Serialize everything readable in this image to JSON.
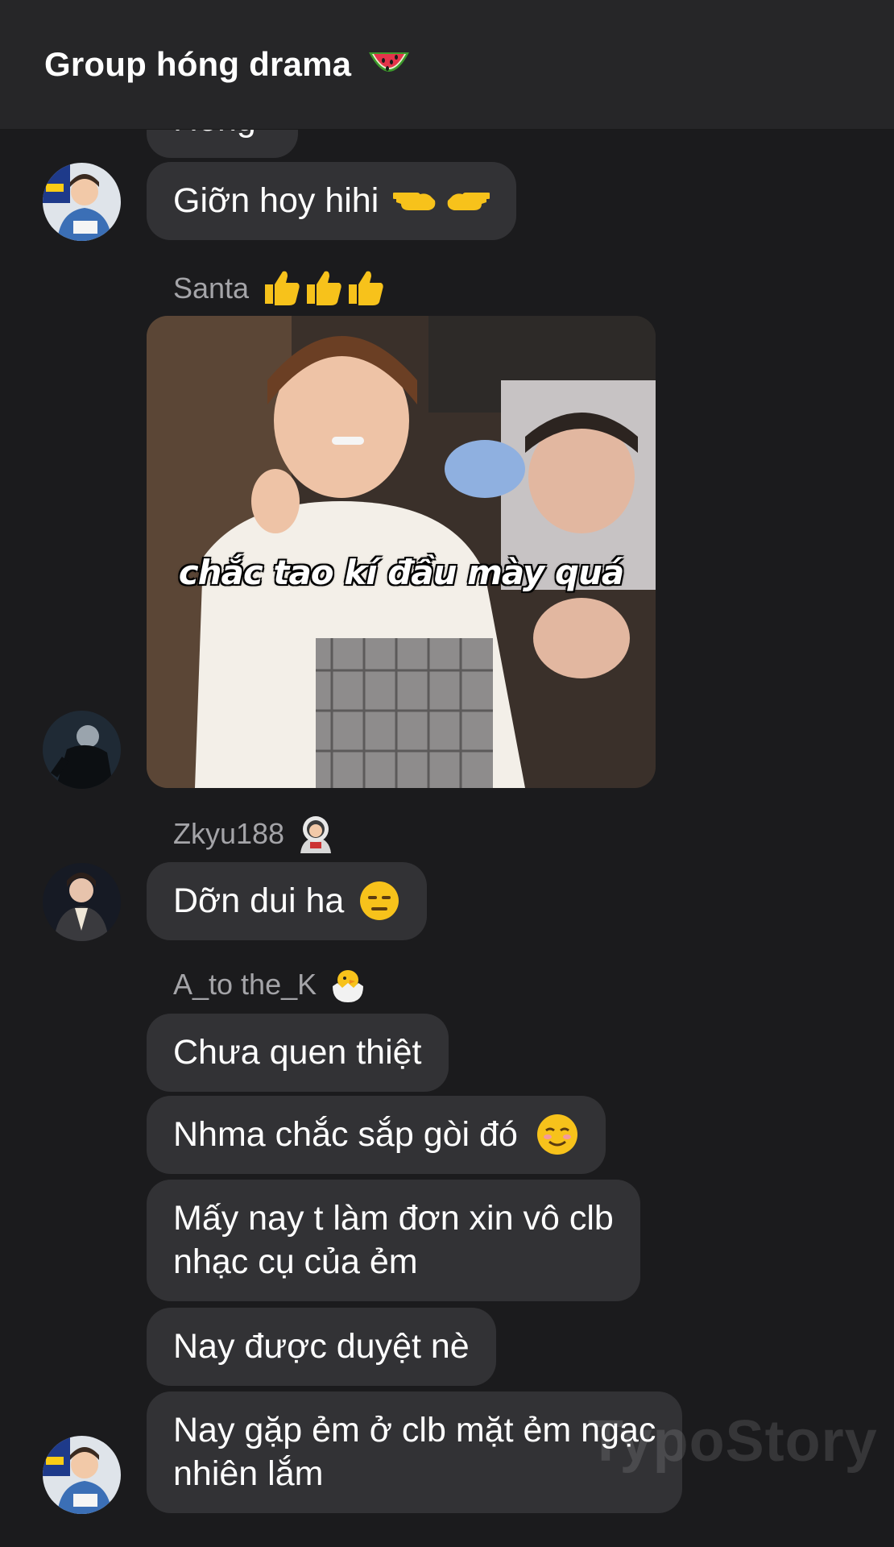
{
  "header": {
    "title": "Group hóng drama"
  },
  "messages": {
    "m0": "Hóng",
    "m1": "Giỡn hoy hihi",
    "santa_name": "Santa",
    "photo_caption": "chắc tao kí đầu mày quá",
    "zkyu_name": "Zkyu188",
    "m2": "Dỡn dui ha",
    "ak_name": "A_to the_K",
    "m3": "Chưa quen thiệt",
    "m4": "Nhma chắc sắp gòi đó",
    "m5_line1": "Mấy nay t làm đơn xin vô clb",
    "m5_line2": "nhạc cụ của ẻm",
    "m6": "Nay được duyệt nè",
    "m7_line1": "Nay gặp ẻm ở clb mặt ẻm ngạc",
    "m7_line2": "nhiên lắm"
  },
  "watermark": "TypoStory",
  "icons": {
    "header": "watermelon-icon",
    "m1": "pointing-hands-icon",
    "santa": "thumbs-up-icon",
    "zkyu": "astronaut-icon",
    "m2": "expressionless-face-icon",
    "ak": "hatching-chick-icon",
    "m4": "smiling-face-icon"
  },
  "colors": {
    "background": "#1b1b1d",
    "header": "#262628",
    "bubble": "#323235",
    "name": "#a4a4a8"
  }
}
